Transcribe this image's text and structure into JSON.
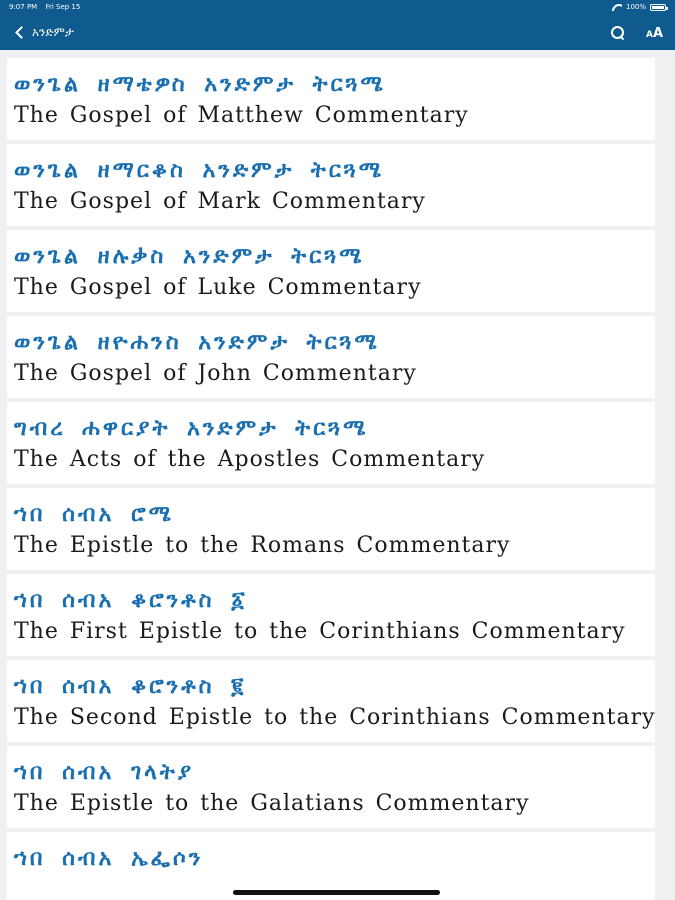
{
  "status_bar": {
    "time": "9:07 PM",
    "date": "Fri Sep 15",
    "battery": "100%"
  },
  "nav": {
    "back_label": "አንድምታ"
  },
  "items": [
    {
      "ge": "ወንጌል ዘማቴዎስ አንድምታ ትርጓሜ",
      "en": "The Gospel of Matthew Commentary"
    },
    {
      "ge": "ወንጌል ዘማርቆስ አንድምታ ትርጓሜ",
      "en": "The Gospel of Mark Commentary"
    },
    {
      "ge": "ወንጌል ዘሉቃስ አንድምታ ትርጓሜ",
      "en": "The Gospel of Luke Commentary"
    },
    {
      "ge": "ወንጌል ዘዮሐንስ አንድምታ ትርጓሜ",
      "en": "The Gospel of John Commentary"
    },
    {
      "ge": "ግብረ ሐዋርያት አንድምታ ትርጓሜ",
      "en": "The Acts of the Apostles Commentary"
    },
    {
      "ge": "ኀበ ሰብአ ሮሜ",
      "en": "The Epistle to the Romans Commentary"
    },
    {
      "ge": "ኀበ ሰብአ ቆሮንቶስ ፩",
      "en": "The First Epistle to the Corinthians Commentary"
    },
    {
      "ge": "ኀበ ሰብአ ቆሮንቶስ ፪",
      "en": "The Second Epistle to the Corinthians Commentary"
    },
    {
      "ge": "ኀበ ሰብአ ገላትያ",
      "en": "The Epistle to the Galatians Commentary"
    },
    {
      "ge": "ኀበ ሰብአ ኤፌሶን",
      "en": ""
    }
  ],
  "colors": {
    "nav_bg": "#0f5a8e",
    "geez_text": "#1a6fb0",
    "english_text": "#1a1a1a",
    "page_bg": "#f0f0f2"
  },
  "icons": {
    "back": "chevron-left-icon",
    "search": "search-icon",
    "font_size": "font-size-icon"
  }
}
